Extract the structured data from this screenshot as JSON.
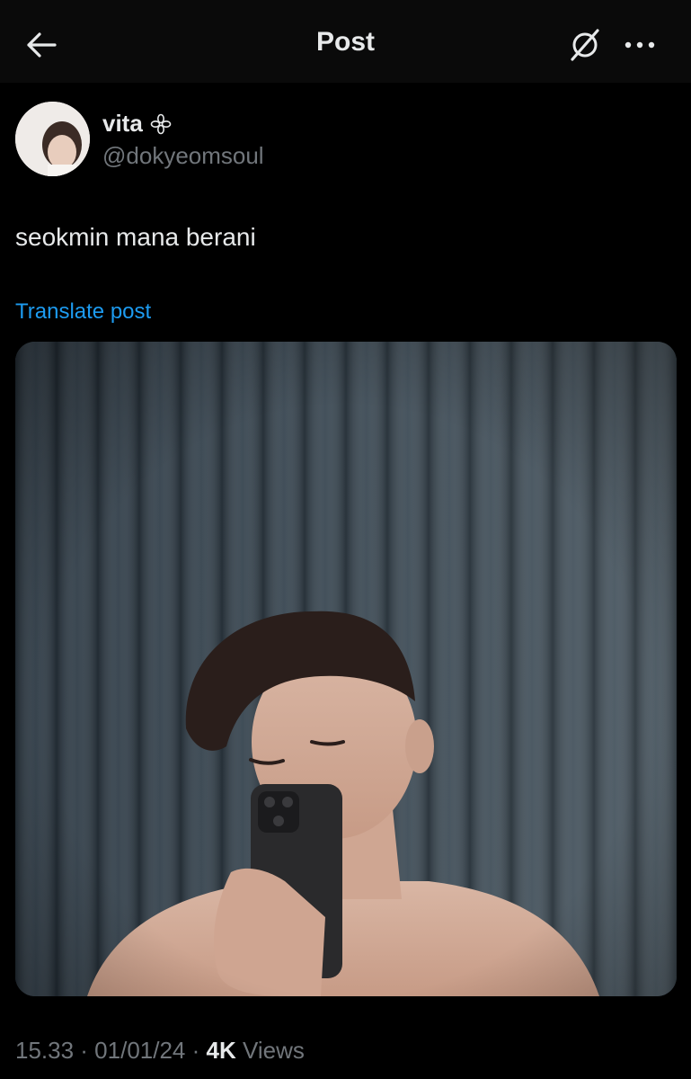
{
  "header": {
    "title": "Post",
    "back_icon": "arrow-left-icon",
    "grok_icon": "grok-icon",
    "more_icon": "more-horizontal-icon"
  },
  "post": {
    "author": {
      "display_name": "vita",
      "handle": "@dokyeomsoul",
      "badge_icon": "clover-icon"
    },
    "text": "seokmin mana berani",
    "translate_label": "Translate post",
    "timestamp": "15.33 · 01/01/24 · ",
    "views_count": "4K",
    "views_label": " Views"
  },
  "colors": {
    "background": "#000000",
    "text_primary": "#e7e9ea",
    "text_secondary": "#71767b",
    "link": "#1d9bf0"
  }
}
